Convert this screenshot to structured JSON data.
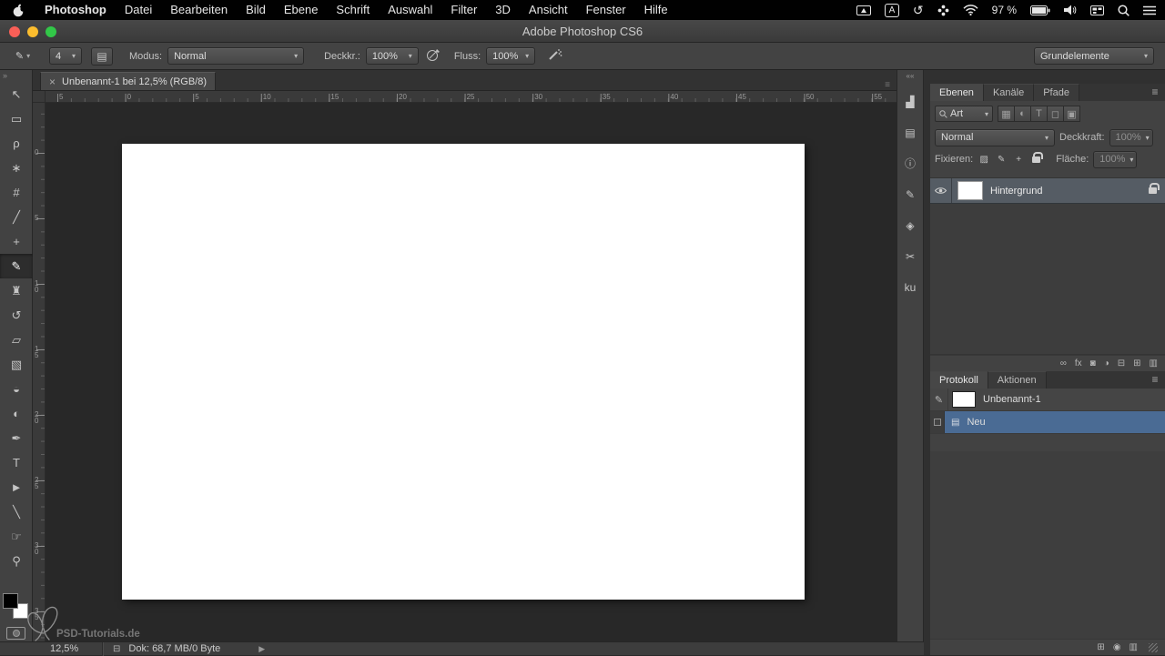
{
  "menubar": {
    "items": [
      "Photoshop",
      "Datei",
      "Bearbeiten",
      "Bild",
      "Ebene",
      "Schrift",
      "Auswahl",
      "Filter",
      "3D",
      "Ansicht",
      "Fenster",
      "Hilfe"
    ],
    "battery": "97 %"
  },
  "window": {
    "title": "Adobe Photoshop CS6",
    "traffic_colors": [
      "#f95f57",
      "#fbbd2e",
      "#32c748"
    ]
  },
  "options": {
    "icons": {
      "preset": "✎",
      "panel": "▤"
    },
    "brush_size": "4",
    "modus_label": "Modus:",
    "modus_value": "Normal",
    "deckkr_label": "Deckkr.:",
    "deckkr_value": "100%",
    "fluss_label": "Fluss:",
    "fluss_value": "100%",
    "workspace": "Grundelemente"
  },
  "doc_tab": {
    "close": "×",
    "title": "Unbenannt-1 bei 12,5% (RGB/8)"
  },
  "tools": [
    {
      "name": "move-tool",
      "glyph": "↖"
    },
    {
      "name": "rectangular-marquee-tool",
      "glyph": "▭"
    },
    {
      "name": "lasso-tool",
      "glyph": "ρ"
    },
    {
      "name": "quick-selection-tool",
      "glyph": "∗"
    },
    {
      "name": "crop-tool",
      "glyph": "#"
    },
    {
      "name": "eyedropper-tool",
      "glyph": "╱"
    },
    {
      "name": "spot-healing-brush-tool",
      "glyph": "+"
    },
    {
      "name": "brush-tool",
      "glyph": "✎",
      "state": "selected"
    },
    {
      "name": "clone-stamp-tool",
      "glyph": "♜"
    },
    {
      "name": "history-brush-tool",
      "glyph": "↺"
    },
    {
      "name": "eraser-tool",
      "glyph": "▱"
    },
    {
      "name": "gradient-tool",
      "glyph": "▧"
    },
    {
      "name": "blur-tool",
      "glyph": "◒"
    },
    {
      "name": "dodge-tool",
      "glyph": "◐"
    },
    {
      "name": "pen-tool",
      "glyph": "✒"
    },
    {
      "name": "type-tool",
      "glyph": "T"
    },
    {
      "name": "path-selection-tool",
      "glyph": "►"
    },
    {
      "name": "line-tool",
      "glyph": "╲"
    },
    {
      "name": "hand-tool",
      "glyph": "☞"
    },
    {
      "name": "zoom-tool",
      "glyph": "⚲"
    }
  ],
  "swatches": {
    "foreground": "#000000",
    "background": "#ffffff"
  },
  "rulers": {
    "h": [
      "5",
      "0",
      "5",
      "10",
      "15",
      "20",
      "25",
      "30",
      "35",
      "40",
      "45",
      "50",
      "55"
    ],
    "v": [
      "0",
      "5",
      "10",
      "15",
      "20",
      "25",
      "30",
      "35"
    ]
  },
  "watermark": {
    "text": "PSD-Tutorials.de"
  },
  "right_strip": [
    {
      "name": "histogram-panel-icon",
      "glyph": "▟"
    },
    {
      "name": "color-panel-icon",
      "glyph": "▤"
    },
    {
      "name": "info-panel-icon",
      "glyph": "ⓘ"
    },
    {
      "name": "brush-presets-panel-icon",
      "glyph": "✎"
    },
    {
      "name": "styles-panel-icon",
      "glyph": "◈"
    },
    {
      "name": "tool-presets-panel-icon",
      "glyph": "✂"
    },
    {
      "name": "kuler-panel-icon",
      "glyph": "ku"
    }
  ],
  "layers_panel": {
    "tabs": [
      "Ebenen",
      "Kanäle",
      "Pfade"
    ],
    "filter_label": "Art",
    "filter_icons": [
      {
        "name": "filter-pixel-layers-icon",
        "glyph": "▦"
      },
      {
        "name": "filter-adjustment-layers-icon",
        "glyph": "◐"
      },
      {
        "name": "filter-type-layers-icon",
        "glyph": "T"
      },
      {
        "name": "filter-shape-layers-icon",
        "glyph": "◻"
      },
      {
        "name": "filter-smart-objects-icon",
        "glyph": "▣"
      }
    ],
    "blend_mode": "Normal",
    "deckkraft_label": "Deckkraft:",
    "deckkraft_value": "100%",
    "fixieren_label": "Fixieren:",
    "lock_icons": {
      "transparency": "▨",
      "paint": "✎",
      "position": "+"
    },
    "flaeche_label": "Fläche:",
    "flaeche_value": "100%",
    "layer_name": "Hintergrund",
    "selected_row_color": "#555c64",
    "bottom_icons": [
      {
        "name": "link-layers-icon",
        "glyph": "∞"
      },
      {
        "name": "layer-style-icon",
        "glyph": "fx"
      },
      {
        "name": "add-layer-mask-icon",
        "glyph": "◙"
      },
      {
        "name": "new-adjustment-layer-icon",
        "glyph": "◑"
      },
      {
        "name": "new-group-icon",
        "glyph": "⊟"
      },
      {
        "name": "new-layer-icon",
        "glyph": "⊞"
      },
      {
        "name": "delete-layer-icon",
        "glyph": "▥"
      }
    ]
  },
  "history_panel": {
    "tabs": [
      "Protokoll",
      "Aktionen"
    ],
    "source_glyph": "✎",
    "snapshot": "Unbenannt-1",
    "state_icon": "▤",
    "state": "Neu",
    "selected_state_color": "#4a6b94",
    "bottom_icons": [
      {
        "name": "new-document-from-state-icon",
        "glyph": "⊞"
      },
      {
        "name": "new-snapshot-icon",
        "glyph": "◉"
      },
      {
        "name": "delete-state-icon",
        "glyph": "▥"
      }
    ]
  },
  "statusbar": {
    "zoom": "12,5%",
    "disk_glyph": "⊟",
    "doc_label": "Dok: 68,7 MB/0 Byte"
  }
}
